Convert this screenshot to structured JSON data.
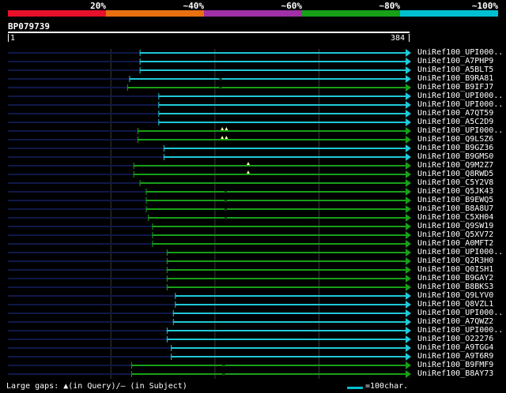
{
  "scale": {
    "labels": [
      "20%",
      "~40%",
      "~60%",
      "~80%",
      "~100%"
    ],
    "colors": [
      "#e8102a",
      "#e87010",
      "#a030a8",
      "#18a018",
      "#00c0d0"
    ]
  },
  "query": {
    "name": "BP079739",
    "start": "1",
    "end": "384",
    "length": 384
  },
  "colors": {
    "green": "#18a018",
    "cyan": "#20c8d8",
    "navy": "#101848",
    "grid": "#3a3a3a"
  },
  "rows": [
    {
      "label": "UniRef100_UPI000..",
      "start": 128,
      "end": 384,
      "color": "cyan"
    },
    {
      "label": "UniRef100_A7PHP9",
      "start": 128,
      "end": 384,
      "color": "cyan"
    },
    {
      "label": "UniRef100_A5BLT5",
      "start": 128,
      "end": 384,
      "color": "cyan"
    },
    {
      "label": "UniRef100_B9RA81",
      "start": 118,
      "end": 384,
      "color": "cyan",
      "subject_gaps": [
        205
      ]
    },
    {
      "label": "UniRef100_B9IFJ7",
      "start": 116,
      "end": 384,
      "color": "green",
      "subject_gaps": [
        205
      ]
    },
    {
      "label": "UniRef100_UPI000..",
      "start": 146,
      "end": 384,
      "color": "cyan"
    },
    {
      "label": "UniRef100_UPI000..",
      "start": 146,
      "end": 384,
      "color": "cyan"
    },
    {
      "label": "UniRef100_A7QT59",
      "start": 146,
      "end": 384,
      "color": "cyan"
    },
    {
      "label": "UniRef100_A5C2D9",
      "start": 146,
      "end": 384,
      "color": "cyan"
    },
    {
      "label": "UniRef100_UPI000..",
      "start": 126,
      "end": 384,
      "color": "green",
      "query_gaps": [
        207,
        211
      ]
    },
    {
      "label": "UniRef100_Q9LSZ6",
      "start": 126,
      "end": 384,
      "color": "green",
      "query_gaps": [
        207,
        211
      ]
    },
    {
      "label": "UniRef100_B9GZ36",
      "start": 151,
      "end": 384,
      "color": "cyan"
    },
    {
      "label": "UniRef100_B9GMS0",
      "start": 151,
      "end": 384,
      "color": "cyan"
    },
    {
      "label": "UniRef100_Q9M2Z7",
      "start": 122,
      "end": 384,
      "color": "green",
      "query_gaps": [
        232
      ]
    },
    {
      "label": "UniRef100_Q8RWD5",
      "start": 122,
      "end": 384,
      "color": "green",
      "query_gaps": [
        232
      ]
    },
    {
      "label": "UniRef100_C5Y2V8",
      "start": 128,
      "end": 384,
      "color": "green"
    },
    {
      "label": "UniRef100_Q5JK43",
      "start": 134,
      "end": 384,
      "color": "green",
      "subject_gaps": [
        210
      ]
    },
    {
      "label": "UniRef100_B9EWQ5",
      "start": 134,
      "end": 384,
      "color": "green",
      "subject_gaps": [
        210
      ]
    },
    {
      "label": "UniRef100_B8A8U7",
      "start": 134,
      "end": 384,
      "color": "green",
      "subject_gaps": [
        210
      ]
    },
    {
      "label": "UniRef100_C5XH04",
      "start": 136,
      "end": 384,
      "color": "green",
      "subject_gaps": [
        210
      ]
    },
    {
      "label": "UniRef100_Q9SW19",
      "start": 140,
      "end": 384,
      "color": "green"
    },
    {
      "label": "UniRef100_Q5XV72",
      "start": 140,
      "end": 384,
      "color": "green"
    },
    {
      "label": "UniRef100_A0MFT2",
      "start": 140,
      "end": 384,
      "color": "green"
    },
    {
      "label": "UniRef100_UPI000..",
      "start": 154,
      "end": 384,
      "color": "green"
    },
    {
      "label": "UniRef100_Q2R3H0",
      "start": 154,
      "end": 384,
      "color": "green"
    },
    {
      "label": "UniRef100_Q0ISH1",
      "start": 154,
      "end": 384,
      "color": "green"
    },
    {
      "label": "UniRef100_B9GAY2",
      "start": 154,
      "end": 384,
      "color": "green"
    },
    {
      "label": "UniRef100_B8BKS3",
      "start": 154,
      "end": 384,
      "color": "green"
    },
    {
      "label": "UniRef100_Q9LYV0",
      "start": 162,
      "end": 384,
      "color": "cyan"
    },
    {
      "label": "UniRef100_Q8VZL1",
      "start": 162,
      "end": 384,
      "color": "cyan"
    },
    {
      "label": "UniRef100_UPI000..",
      "start": 160,
      "end": 384,
      "color": "cyan"
    },
    {
      "label": "UniRef100_A7QWZ2",
      "start": 160,
      "end": 384,
      "color": "cyan"
    },
    {
      "label": "UniRef100_UPI000..",
      "start": 154,
      "end": 384,
      "color": "cyan"
    },
    {
      "label": "UniRef100_O22276",
      "start": 154,
      "end": 384,
      "color": "cyan"
    },
    {
      "label": "UniRef100_A9TGG4",
      "start": 158,
      "end": 384,
      "color": "cyan"
    },
    {
      "label": "UniRef100_A9T6R9",
      "start": 158,
      "end": 384,
      "color": "cyan"
    },
    {
      "label": "UniRef100_B9FMF9",
      "start": 120,
      "end": 384,
      "color": "green",
      "subject_gaps": [
        208
      ]
    },
    {
      "label": "UniRef100_B8AY73",
      "start": 120,
      "end": 384,
      "color": "green",
      "subject_gaps": [
        208
      ]
    }
  ],
  "footer": {
    "text": "Large gaps: ▲(in Query)/– (in Subject)",
    "legend": "=100char."
  }
}
